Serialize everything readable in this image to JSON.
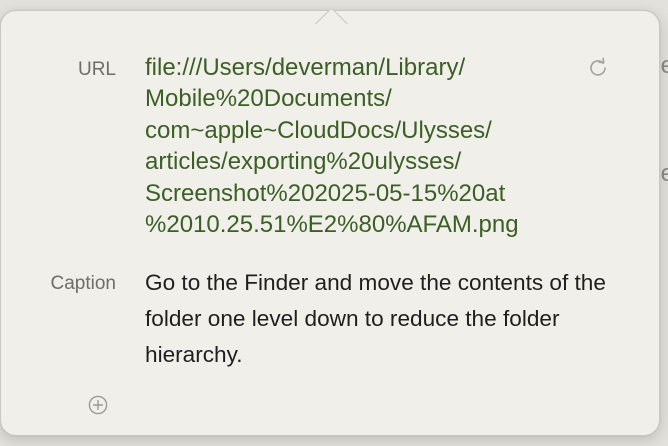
{
  "url_field": {
    "label": "URL",
    "value_lines": [
      "file:///Users/deverman/Library/",
      "Mobile%20Documents/",
      "com~apple~CloudDocs/Ulysses/",
      "articles/exporting%20ulysses/",
      "Screenshot%202025-05-15%20at",
      "%2010.25.51%E2%80%AFAM.png"
    ],
    "reload_icon": "arrow-clockwise"
  },
  "caption_field": {
    "label": "Caption",
    "value": "Go to the Finder and move the contents of the folder one level down to reduce the folder hierarchy."
  },
  "add_icon": "plus-circle",
  "colors": {
    "url_text": "#3c5f26",
    "label_text": "#6d6d69",
    "caption_text": "#1f1f1f",
    "popover_bg": "#f0efe9"
  }
}
